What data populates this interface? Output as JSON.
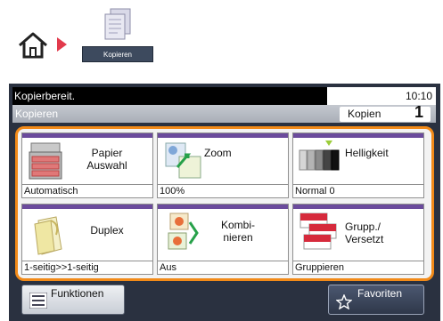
{
  "breadcrumb": {
    "home_icon": "home-icon",
    "separator_icon": "arrow-right-icon",
    "separator_color": "#e23a4c",
    "app_icon": "copy-document-icon",
    "app_label": "Kopieren"
  },
  "status": {
    "message": "Kopierbereit.",
    "time": "10:10"
  },
  "header": {
    "title": "Kopieren",
    "copies_label": "Kopien",
    "copies_count": "1"
  },
  "functions": [
    {
      "label": "Papier\nAuswahl",
      "value": "Automatisch",
      "icon": "printer-paper-icon"
    },
    {
      "label": "Zoom",
      "value": "100%",
      "icon": "zoom-icon"
    },
    {
      "label": "Helligkeit",
      "value": "Normal 0",
      "icon": "brightness-icon"
    },
    {
      "label": "Duplex",
      "value": "1-seitig>>1-seitig",
      "icon": "duplex-icon"
    },
    {
      "label": "Kombi-\nnieren",
      "value": "Aus",
      "icon": "combine-icon"
    },
    {
      "label": "Grupp./\nVersetzt",
      "value": "Gruppieren",
      "icon": "collate-icon"
    }
  ],
  "footer": {
    "functions_label": "Funktionen",
    "functions_icon": "list-icon",
    "favorites_label": "Favoriten",
    "favorites_icon": "star-icon"
  },
  "colors": {
    "accent_orange": "#f28a18",
    "stripe_purple": "#6b4b9c",
    "panel_dark": "#2a3140"
  }
}
